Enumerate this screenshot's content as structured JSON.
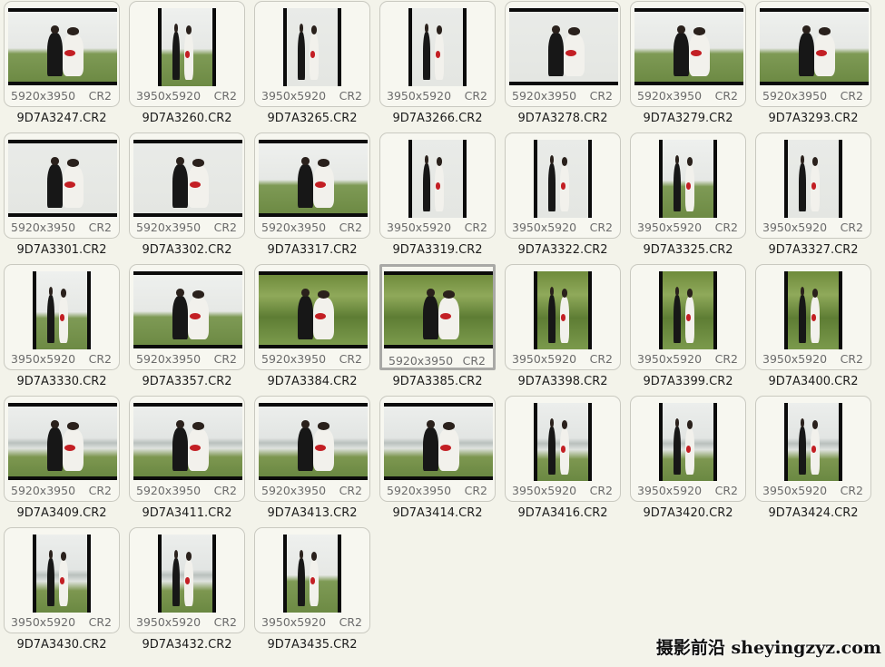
{
  "items": [
    {
      "name": "9D7A3247.CR2",
      "dims": "5920x3950",
      "type": "CR2",
      "orientation": "landscape",
      "scene": "field",
      "selected": false
    },
    {
      "name": "9D7A3260.CR2",
      "dims": "3950x5920",
      "type": "CR2",
      "orientation": "portrait",
      "scene": "field",
      "selected": false
    },
    {
      "name": "9D7A3265.CR2",
      "dims": "3950x5920",
      "type": "CR2",
      "orientation": "portrait",
      "scene": "close",
      "selected": false
    },
    {
      "name": "9D7A3266.CR2",
      "dims": "3950x5920",
      "type": "CR2",
      "orientation": "portrait",
      "scene": "close",
      "selected": false
    },
    {
      "name": "9D7A3278.CR2",
      "dims": "5920x3950",
      "type": "CR2",
      "orientation": "landscape",
      "scene": "close",
      "selected": false
    },
    {
      "name": "9D7A3279.CR2",
      "dims": "5920x3950",
      "type": "CR2",
      "orientation": "landscape",
      "scene": "field",
      "selected": false
    },
    {
      "name": "9D7A3293.CR2",
      "dims": "5920x3950",
      "type": "CR2",
      "orientation": "landscape",
      "scene": "field",
      "selected": false
    },
    {
      "name": "9D7A3301.CR2",
      "dims": "5920x3950",
      "type": "CR2",
      "orientation": "landscape",
      "scene": "close",
      "selected": false
    },
    {
      "name": "9D7A3302.CR2",
      "dims": "5920x3950",
      "type": "CR2",
      "orientation": "landscape",
      "scene": "close",
      "selected": false
    },
    {
      "name": "9D7A3317.CR2",
      "dims": "5920x3950",
      "type": "CR2",
      "orientation": "landscape",
      "scene": "field",
      "selected": false
    },
    {
      "name": "9D7A3319.CR2",
      "dims": "3950x5920",
      "type": "CR2",
      "orientation": "portrait",
      "scene": "close",
      "selected": false
    },
    {
      "name": "9D7A3322.CR2",
      "dims": "3950x5920",
      "type": "CR2",
      "orientation": "portrait",
      "scene": "close",
      "selected": false
    },
    {
      "name": "9D7A3325.CR2",
      "dims": "3950x5920",
      "type": "CR2",
      "orientation": "portrait",
      "scene": "field",
      "selected": false
    },
    {
      "name": "9D7A3327.CR2",
      "dims": "3950x5920",
      "type": "CR2",
      "orientation": "portrait",
      "scene": "close",
      "selected": false
    },
    {
      "name": "9D7A3330.CR2",
      "dims": "3950x5920",
      "type": "CR2",
      "orientation": "portrait",
      "scene": "field",
      "selected": false
    },
    {
      "name": "9D7A3357.CR2",
      "dims": "5920x3950",
      "type": "CR2",
      "orientation": "landscape",
      "scene": "field",
      "selected": false
    },
    {
      "name": "9D7A3384.CR2",
      "dims": "5920x3950",
      "type": "CR2",
      "orientation": "landscape",
      "scene": "grass",
      "selected": false
    },
    {
      "name": "9D7A3385.CR2",
      "dims": "5920x3950",
      "type": "CR2",
      "orientation": "landscape",
      "scene": "grass",
      "selected": true
    },
    {
      "name": "9D7A3398.CR2",
      "dims": "3950x5920",
      "type": "CR2",
      "orientation": "portrait",
      "scene": "grass",
      "selected": false
    },
    {
      "name": "9D7A3399.CR2",
      "dims": "3950x5920",
      "type": "CR2",
      "orientation": "portrait",
      "scene": "grass",
      "selected": false
    },
    {
      "name": "9D7A3400.CR2",
      "dims": "3950x5920",
      "type": "CR2",
      "orientation": "portrait",
      "scene": "grass",
      "selected": false
    },
    {
      "name": "9D7A3409.CR2",
      "dims": "5920x3950",
      "type": "CR2",
      "orientation": "landscape",
      "scene": "sea",
      "selected": false
    },
    {
      "name": "9D7A3411.CR2",
      "dims": "5920x3950",
      "type": "CR2",
      "orientation": "landscape",
      "scene": "sea",
      "selected": false
    },
    {
      "name": "9D7A3413.CR2",
      "dims": "5920x3950",
      "type": "CR2",
      "orientation": "landscape",
      "scene": "sea",
      "selected": false
    },
    {
      "name": "9D7A3414.CR2",
      "dims": "5920x3950",
      "type": "CR2",
      "orientation": "landscape",
      "scene": "sea",
      "selected": false
    },
    {
      "name": "9D7A3416.CR2",
      "dims": "3950x5920",
      "type": "CR2",
      "orientation": "portrait",
      "scene": "sea",
      "selected": false
    },
    {
      "name": "9D7A3420.CR2",
      "dims": "3950x5920",
      "type": "CR2",
      "orientation": "portrait",
      "scene": "sea",
      "selected": false
    },
    {
      "name": "9D7A3424.CR2",
      "dims": "3950x5920",
      "type": "CR2",
      "orientation": "portrait",
      "scene": "sea",
      "selected": false
    },
    {
      "name": "9D7A3430.CR2",
      "dims": "3950x5920",
      "type": "CR2",
      "orientation": "portrait",
      "scene": "sea",
      "selected": false
    },
    {
      "name": "9D7A3432.CR2",
      "dims": "3950x5920",
      "type": "CR2",
      "orientation": "portrait",
      "scene": "sea",
      "selected": false
    },
    {
      "name": "9D7A3435.CR2",
      "dims": "3950x5920",
      "type": "CR2",
      "orientation": "portrait",
      "scene": "field",
      "selected": false
    }
  ],
  "watermark": "摄影前沿 sheyingzyz.com"
}
